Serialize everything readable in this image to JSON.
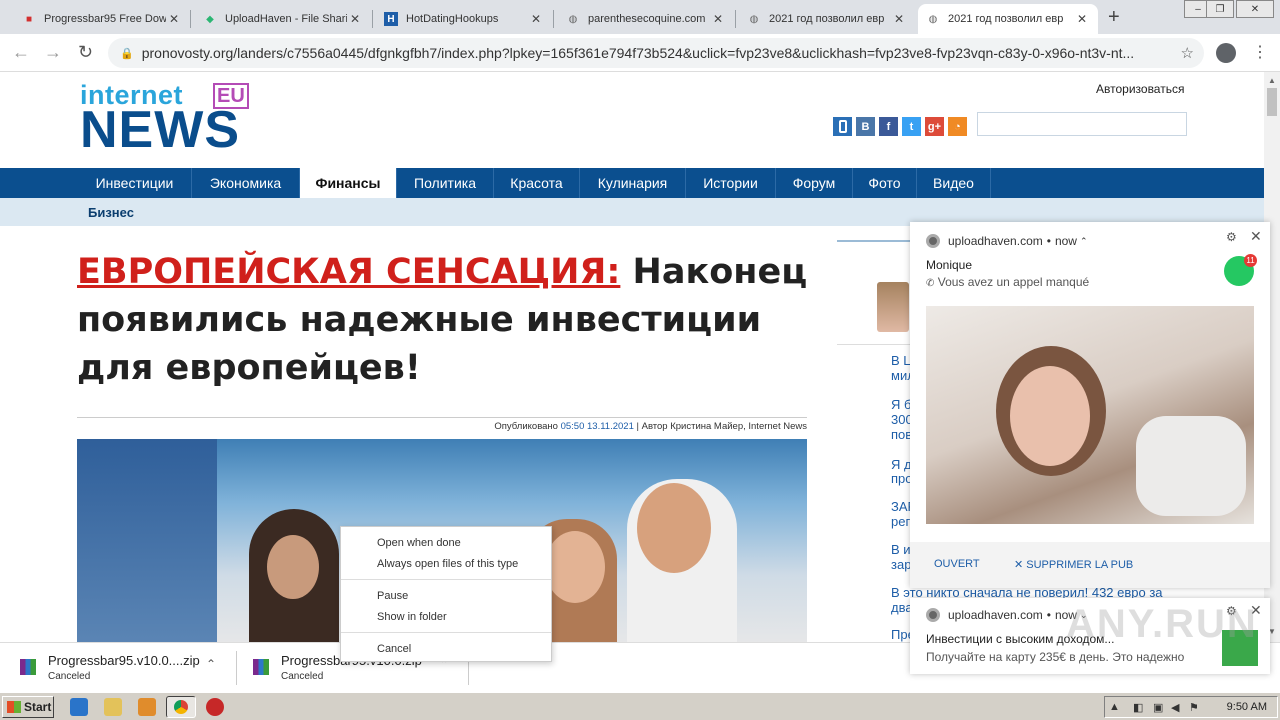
{
  "browser": {
    "tabs": [
      {
        "title": "Progressbar95 Free Dow",
        "icon": "red-box-icon"
      },
      {
        "title": "UploadHaven - File Shari",
        "icon": "uploadhaven-icon"
      },
      {
        "title": "HotDatingHookups",
        "icon": "h-icon"
      },
      {
        "title": "parenthesecoquine.com",
        "icon": "globe-icon"
      },
      {
        "title": "2021 год позволил евр",
        "icon": "globe-icon"
      },
      {
        "title": "2021 год позволил евр",
        "icon": "globe-icon"
      }
    ],
    "active_tab_index": 5,
    "url": "pronovosty.org/landers/c7556a0445/dfgnkgfbh7/index.php?lpkey=165f361e794f73b524&uclick=fvp23ve8&uclickhash=fvp23ve8-fvp23vqn-c83y-0-x96o-nt3v-nt..."
  },
  "site": {
    "logo_top": "internet",
    "logo_eu": "EU",
    "logo_bottom": "NEWS",
    "login": "Авторизоваться",
    "social": [
      {
        "label": "",
        "color": "#2a6fb6",
        "icon": "mobile-icon"
      },
      {
        "label": "B",
        "color": "#4a76a8",
        "icon": "vk-icon"
      },
      {
        "label": "f",
        "color": "#3b5998",
        "icon": "facebook-icon"
      },
      {
        "label": "t",
        "color": "#38a1f3",
        "icon": "twitter-icon"
      },
      {
        "label": "g+",
        "color": "#dd4b39",
        "icon": "google-plus-icon"
      },
      {
        "label": "",
        "color": "#f08a24",
        "icon": "rss-icon"
      }
    ],
    "nav": [
      "Инвестиции",
      "Экономика",
      "Финансы",
      "Политика",
      "Красота",
      "Кулинария",
      "Истории",
      "Форум",
      "Фото",
      "Видео"
    ],
    "nav_active": "Финансы",
    "subnav": "Бизнес"
  },
  "article": {
    "headline_red": "ЕВРОПЕЙСКАЯ СЕНСАЦИЯ:",
    "headline_rest": " Наконец появились надежные инвестиции для европейцев!",
    "byline_prefix": "Опубликовано ",
    "byline_time": "05:50 13.11.2021",
    "byline_suffix": " | Автор Кристина Майер, Internet News"
  },
  "sidebar": {
    "links": [
      "В Ц",
      "мил",
      "Я б",
      "300",
      "пов",
      "Я д",
      "про",
      "ЗАР",
      "рег",
      "В и",
      "зар",
      "В это никто сначала не поверил! 432 евро за",
      "два",
      "Пре"
    ]
  },
  "notification1": {
    "source": "uploadhaven.com",
    "time": "now",
    "title": "Monique",
    "body": "Vous avez un appel manqué",
    "badge": "11",
    "button_open": "OUVERT",
    "button_delete": "SUPPRIMER LA PUB"
  },
  "notification2": {
    "source": "uploadhaven.com",
    "time": "now",
    "title": "Инвестиции с высоким доходом...",
    "body": "Получайте на карту 235€ в день. Это надежно"
  },
  "context_menu": {
    "items": [
      "Open when done",
      "Always open files of this type",
      "Pause",
      "Show in folder",
      "Cancel"
    ]
  },
  "downloads": [
    {
      "name": "Progressbar95.v10.0....zip",
      "status": "Canceled"
    },
    {
      "name": "Progressbar95.v10.0.zip",
      "status": "Canceled"
    }
  ],
  "taskbar": {
    "start": "Start",
    "clock": "9:50 AM"
  },
  "watermark": "ANY.RUN"
}
